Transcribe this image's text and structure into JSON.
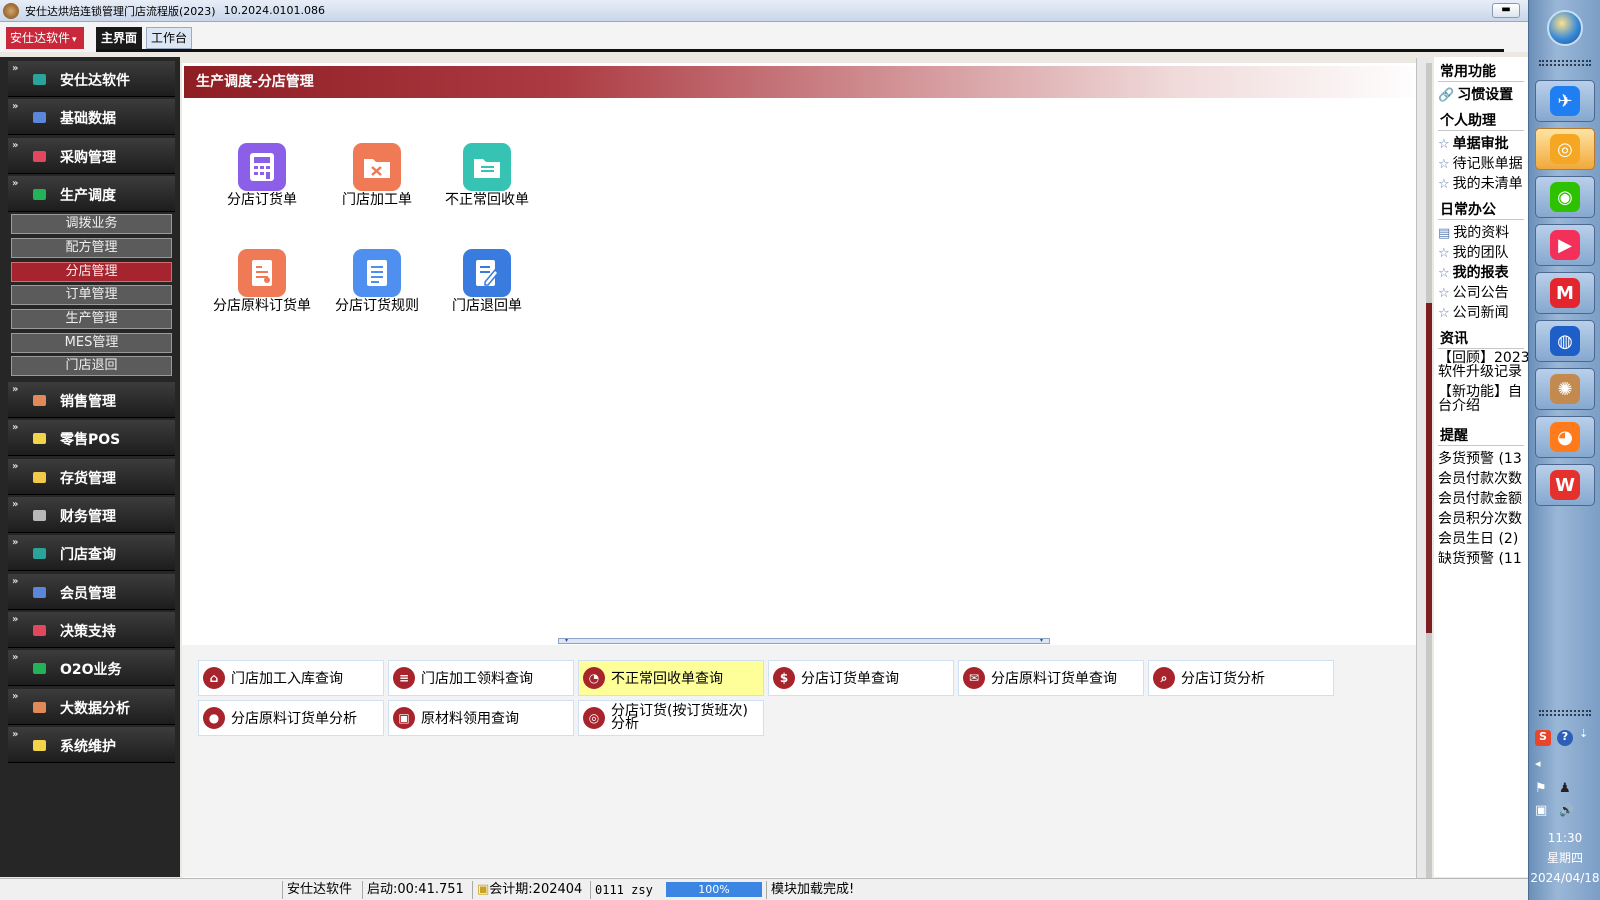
{
  "window": {
    "title": "安仕达烘焙连锁管理门店流程版(2023)",
    "version": "10.2024.0101.086",
    "minimize_icon": "minimize-icon"
  },
  "menubar": {
    "brand_menu": "安仕达软件",
    "brand_arrow": "▾",
    "tabs": [
      "主界面",
      "工作台"
    ]
  },
  "sidebar": {
    "items": [
      {
        "label": "安仕达软件",
        "color": "#2aa39a"
      },
      {
        "label": "基础数据",
        "color": "#5b86d9"
      },
      {
        "label": "采购管理",
        "color": "#e2475e"
      },
      {
        "label": "生产调度",
        "color": "#22b35a",
        "expanded": true
      },
      {
        "label": "销售管理",
        "color": "#e08a5a"
      },
      {
        "label": "零售POS",
        "color": "#f2d44a"
      },
      {
        "label": "存货管理",
        "color": "#f3c94a"
      },
      {
        "label": "财务管理",
        "color": "#b8b8b8"
      },
      {
        "label": "门店查询",
        "color": "#2aa39a"
      },
      {
        "label": "会员管理",
        "color": "#5b86d9"
      },
      {
        "label": "决策支持",
        "color": "#e2475e"
      },
      {
        "label": "O2O业务",
        "color": "#22b35a"
      },
      {
        "label": "大数据分析",
        "color": "#e08a5a"
      },
      {
        "label": "系统维护",
        "color": "#f2d44a"
      }
    ],
    "chevron": "»",
    "subitems": [
      "调拨业务",
      "配方管理",
      "分店管理",
      "订单管理",
      "生产管理",
      "MES管理",
      "门店退回"
    ],
    "active_sub": "分店管理"
  },
  "main": {
    "header": "生产调度-分店管理",
    "tiles": [
      {
        "label": "分店订货单",
        "icon": "calculator-icon",
        "color": "#8b5fe8"
      },
      {
        "label": "门店加工单",
        "icon": "tools-folder-icon",
        "color": "#f07a55"
      },
      {
        "label": "不正常回收单",
        "icon": "document-folder-icon",
        "color": "#36c3b3"
      },
      {
        "label": "分店原料订货单",
        "icon": "ingredients-list-icon",
        "color": "#f07a55"
      },
      {
        "label": "分店订货规则",
        "icon": "rules-list-icon",
        "color": "#4f8ff0"
      },
      {
        "label": "门店退回单",
        "icon": "return-edit-icon",
        "color": "#3a7be0"
      }
    ],
    "divider_arrows": [
      "▾",
      "▾"
    ],
    "queries": [
      {
        "label": "门店加工入库查询",
        "icon": "warehouse-icon",
        "glyph": "⌂"
      },
      {
        "label": "门店加工领料查询",
        "icon": "layers-icon",
        "glyph": "≡"
      },
      {
        "label": "不正常回收单查询",
        "icon": "pie-chart-icon",
        "glyph": "◔",
        "highlight": true
      },
      {
        "label": "分店订货单查询",
        "icon": "dollar-icon",
        "glyph": "$"
      },
      {
        "label": "分店原料订货单查询",
        "icon": "mail-icon",
        "glyph": "✉"
      },
      {
        "label": "分店订货分析",
        "icon": "magnifier-icon",
        "glyph": "⌕"
      },
      {
        "label": "分店原料订货单分析",
        "icon": "person-icon",
        "glyph": "●"
      },
      {
        "label": "原材料领用查询",
        "icon": "monitor-icon",
        "glyph": "▣"
      },
      {
        "label": "分店订货(按订货班次)分析",
        "icon": "lifebuoy-icon",
        "glyph": "◎"
      }
    ]
  },
  "right_panel": {
    "sections": [
      {
        "title": "常用功能",
        "items": [
          {
            "label": "习惯设置",
            "bold": true,
            "icon": "link-icon",
            "glyph": "🔗"
          }
        ]
      },
      {
        "title": "个人助理",
        "items": [
          {
            "label": "单据审批",
            "bold": true,
            "icon": "star-icon",
            "glyph": "☆"
          },
          {
            "label": "待记账单据",
            "icon": "star-icon",
            "glyph": "☆"
          },
          {
            "label": "我的未清单",
            "icon": "star-icon",
            "glyph": "☆"
          }
        ]
      },
      {
        "title": "日常办公",
        "items": [
          {
            "label": "我的资料",
            "icon": "calendar-icon",
            "glyph": "▤"
          },
          {
            "label": "我的团队",
            "icon": "star-icon",
            "glyph": "☆"
          },
          {
            "label": "我的报表",
            "bold": true,
            "icon": "star-icon",
            "glyph": "☆"
          },
          {
            "label": "公司公告",
            "icon": "star-icon",
            "glyph": "☆"
          },
          {
            "label": "公司新闻",
            "icon": "star-icon",
            "glyph": "☆"
          }
        ]
      },
      {
        "title": "资讯",
        "items": [
          {
            "label": "【回顾】2023",
            "line2": "软件升级记录"
          },
          {
            "label": "【新功能】自",
            "line2": "台介绍"
          }
        ]
      },
      {
        "title": "提醒",
        "items": [
          {
            "label": "多货预警 (13"
          },
          {
            "label": "会员付款次数"
          },
          {
            "label": "会员付款金额"
          },
          {
            "label": "会员积分次数"
          },
          {
            "label": "会员生日 (2)"
          },
          {
            "label": "缺货预警 (11"
          }
        ]
      }
    ]
  },
  "statusbar": {
    "company": "安仕达软件",
    "startup": "启动:00:41.751",
    "period": "会计期:202404",
    "user": "0111 zsy",
    "progress_label": "100%",
    "progress": 1.0,
    "message": "模块加载完成!"
  },
  "taskbar": {
    "apps": [
      {
        "icon": "feishu-icon",
        "color": "#1f7ef2",
        "glyph": "✈"
      },
      {
        "icon": "search-chat-icon",
        "color": "#f5a623",
        "glyph": "◎",
        "active": true
      },
      {
        "icon": "wechat-icon",
        "color": "#2dc100",
        "glyph": "◉"
      },
      {
        "icon": "video-play-icon",
        "color": "#f2305a",
        "glyph": "▶"
      },
      {
        "icon": "m-app-icon",
        "color": "#e3262e",
        "glyph": "M"
      },
      {
        "icon": "globe-browser-icon",
        "color": "#1e5fc7",
        "glyph": "◍"
      },
      {
        "icon": "bakery-app-icon",
        "color": "#c28a4e",
        "glyph": "✺"
      },
      {
        "icon": "firefox-icon",
        "color": "#ff7a1a",
        "glyph": "◕"
      },
      {
        "icon": "wps-icon",
        "color": "#e5312e",
        "glyph": "W"
      }
    ],
    "tray": {
      "ime": "S",
      "help": "?",
      "more": "⇣",
      "collapse": "◂",
      "flag": "⚑",
      "qq": "♟",
      "network": "▣",
      "volume": "🔊"
    },
    "time": "11:30",
    "weekday": "星期四",
    "date": "2024/04/18"
  }
}
